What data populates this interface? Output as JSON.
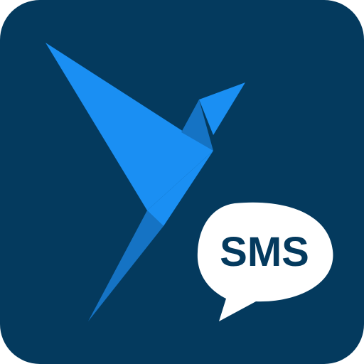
{
  "icon": {
    "badge_text": "SMS",
    "logo": "origami-bird-icon",
    "badge": "speech-bubble-icon",
    "colors": {
      "background": "#043a5e",
      "bird_primary": "#1a8ff3",
      "bird_shade": "#1573c4",
      "bubble_fill": "#ffffff",
      "badge_text": "#043a5e"
    }
  }
}
